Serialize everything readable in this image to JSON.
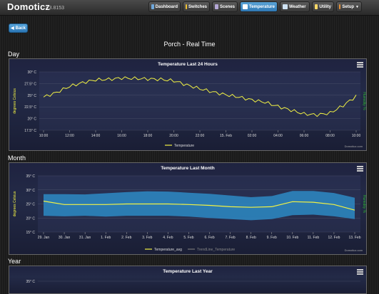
{
  "app": {
    "brand": "Domoticz",
    "version": "V3.8153"
  },
  "nav": [
    {
      "label": "Dashboard",
      "icon": "dashboard-icon",
      "color": "#6fa8dc",
      "active": false
    },
    {
      "label": "Switches",
      "icon": "bulb-icon",
      "color": "#f1c232",
      "active": false
    },
    {
      "label": "Scenes",
      "icon": "scenes-icon",
      "color": "#b4a7d6",
      "active": false
    },
    {
      "label": "Temperature",
      "icon": "thermometer-icon",
      "color": "#ffffff",
      "active": true
    },
    {
      "label": "Weather",
      "icon": "cloud-icon",
      "color": "#cfe2f3",
      "active": false
    },
    {
      "label": "Utility",
      "icon": "utility-icon",
      "color": "#ffd966",
      "active": false
    },
    {
      "label": "Setup",
      "icon": "gear-icon",
      "color": "#e69138",
      "active": false
    }
  ],
  "back_label": "Back",
  "page_title": "Porch - Real Time",
  "sections": {
    "day": "Day",
    "month": "Month",
    "year": "Year"
  },
  "credit": "Domoticz.com",
  "colors": {
    "temp_line": "#f2f244",
    "range_fill": "#2d8ac4",
    "trend_line": "#2cb52c",
    "axis_text": "#dddddd"
  },
  "chart_data": [
    {
      "type": "line",
      "title": "Temperature Last 24 Hours",
      "ylabel": "degrees Celsius",
      "ylabel_right": "Humidity %",
      "yticks": [
        "30° C",
        "27.5° C",
        "25° C",
        "22.5° C",
        "20° C",
        "17.5° C"
      ],
      "ylim": [
        17.5,
        30
      ],
      "xticks": [
        "10:00",
        "12:00",
        "14:00",
        "16:00",
        "18:00",
        "20:00",
        "22:00",
        "15. Feb",
        "02:00",
        "04:00",
        "06:00",
        "08:00",
        "10:00"
      ],
      "series": [
        {
          "name": "Temperature",
          "x": [
            0,
            1,
            2,
            3,
            4,
            5,
            6,
            7,
            8,
            9,
            10,
            11,
            12,
            13,
            14,
            15,
            16,
            17,
            18,
            19,
            20,
            21,
            22,
            23,
            24
          ],
          "values": [
            24.6,
            25.6,
            26.9,
            27.7,
            28.3,
            28.4,
            28.7,
            28.6,
            28.5,
            28.4,
            28.1,
            27.2,
            26.4,
            25.7,
            25.1,
            24.6,
            24.0,
            23.5,
            22.6,
            21.8,
            21.0,
            20.8,
            21.2,
            22.8,
            24.8
          ]
        }
      ]
    },
    {
      "type": "area",
      "title": "Temperature Last Month",
      "ylabel": "degrees Celsius",
      "ylabel_right": "Humidity %",
      "yticks": [
        "35° C",
        "30° C",
        "25° C",
        "20° C",
        "15° C"
      ],
      "ylim": [
        15,
        35
      ],
      "xticks": [
        "29. Jan",
        "30. Jan",
        "31. Jan",
        "1. Feb",
        "2. Feb",
        "3. Feb",
        "4. Feb",
        "5. Feb",
        "6. Feb",
        "7. Feb",
        "8. Feb",
        "9. Feb",
        "10. Feb",
        "11. Feb",
        "12. Feb",
        "13. Feb"
      ],
      "legend": [
        "Temperature_avg",
        "TrendLine_Temperature"
      ],
      "series": [
        {
          "name": "Temperature_avg",
          "values": [
            26.0,
            24.8,
            24.8,
            24.8,
            25.0,
            25.0,
            25.0,
            24.8,
            24.5,
            24.0,
            23.8,
            24.0,
            25.8,
            25.6,
            24.8,
            22.8
          ]
        },
        {
          "name": "max",
          "values": [
            28.5,
            28.5,
            28.4,
            28.8,
            29.2,
            29.5,
            29.4,
            29.0,
            28.6,
            28.0,
            27.4,
            27.8,
            29.6,
            29.6,
            28.9,
            27.2
          ]
        },
        {
          "name": "min",
          "values": [
            20.8,
            20.6,
            20.8,
            20.5,
            20.8,
            20.8,
            20.8,
            20.5,
            20.0,
            19.6,
            19.2,
            19.6,
            21.0,
            21.2,
            20.6,
            19.6
          ]
        }
      ]
    },
    {
      "type": "line",
      "title": "Temperature Last Year",
      "yticks": [
        "35° C"
      ]
    }
  ]
}
